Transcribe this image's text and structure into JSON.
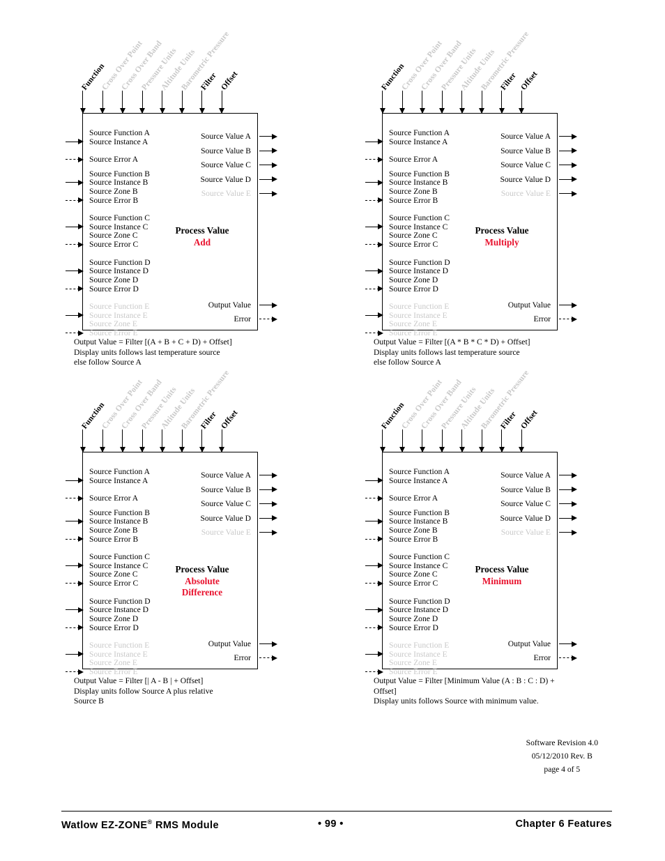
{
  "page": {
    "background": "#ffffff",
    "dim_color": "#c9c9c9",
    "accent_color": "#e8112d"
  },
  "parameters": [
    {
      "label": "Function",
      "dim": false
    },
    {
      "label": "Cross Over Point",
      "dim": true
    },
    {
      "label": "Cross Over Band",
      "dim": true
    },
    {
      "label": "Pressure Units",
      "dim": true
    },
    {
      "label": "Altitude Units",
      "dim": true
    },
    {
      "label": "Barometric Pressure",
      "dim": true
    },
    {
      "label": "Filter",
      "dim": false
    },
    {
      "label": "Offset",
      "dim": false
    }
  ],
  "inputs": [
    {
      "label": "Source Function A",
      "dim": false,
      "arrow": "none"
    },
    {
      "label": "Source Instance A",
      "dim": false,
      "arrow": "solid"
    },
    {
      "label": "Source Error A",
      "dim": false,
      "arrow": "dashed"
    },
    {
      "label": "Source Function B",
      "dim": false,
      "arrow": "none"
    },
    {
      "label": "Source Instance B",
      "dim": false,
      "arrow": "solid"
    },
    {
      "label": "Source Zone B",
      "dim": false,
      "arrow": "none"
    },
    {
      "label": "Source Error B",
      "dim": false,
      "arrow": "dashed"
    },
    {
      "label": "Source Function C",
      "dim": false,
      "arrow": "none"
    },
    {
      "label": "Source Instance C",
      "dim": false,
      "arrow": "solid"
    },
    {
      "label": "Source Zone C",
      "dim": false,
      "arrow": "none"
    },
    {
      "label": "Source Error C",
      "dim": false,
      "arrow": "dashed"
    },
    {
      "label": "Source Function D",
      "dim": false,
      "arrow": "none"
    },
    {
      "label": "Source Instance D",
      "dim": false,
      "arrow": "solid"
    },
    {
      "label": "Source Zone D",
      "dim": false,
      "arrow": "none"
    },
    {
      "label": "Source Error D",
      "dim": false,
      "arrow": "dashed"
    },
    {
      "label": "Source Function E",
      "dim": true,
      "arrow": "none"
    },
    {
      "label": "Source Instance E",
      "dim": true,
      "arrow": "solid"
    },
    {
      "label": "Source Zone E",
      "dim": true,
      "arrow": "none"
    },
    {
      "label": "Source Error E",
      "dim": true,
      "arrow": "dashed"
    }
  ],
  "outputs": [
    {
      "label": "Source Value A",
      "dim": false,
      "arrow": "solid"
    },
    {
      "label": "Source Value B",
      "dim": false,
      "arrow": "solid"
    },
    {
      "label": "Source Value C",
      "dim": false,
      "arrow": "solid"
    },
    {
      "label": "Source Value D",
      "dim": false,
      "arrow": "solid"
    },
    {
      "label": "Source Value E",
      "dim": true,
      "arrow": "solid"
    },
    {
      "label": "Output Value",
      "dim": false,
      "arrow": "solid"
    },
    {
      "label": "Error",
      "dim": false,
      "arrow": "dashed"
    }
  ],
  "diagrams": [
    {
      "title": "Process Value",
      "operation": "Add",
      "operation_lines": [
        "Add"
      ],
      "caption": [
        "Output Value = Filter [(A + B + C + D) + Offset]",
        "Display units follows last temperature source",
        "else follow Source A"
      ]
    },
    {
      "title": "Process Value",
      "operation": "Multiply",
      "operation_lines": [
        "Multiply"
      ],
      "caption": [
        "Output Value = Filter [(A * B * C * D) + Offset]",
        "Display units follows last temperature source",
        "else follow Source A"
      ]
    },
    {
      "title": "Process Value",
      "operation": "Absolute Difference",
      "operation_lines": [
        "Absolute",
        "Difference"
      ],
      "caption": [
        "Output Value = Filter [| A -  B | + Offset]",
        "Display units follow Source A plus relative",
        "Source B"
      ]
    },
    {
      "title": "Process Value",
      "operation": "Minimum",
      "operation_lines": [
        "Minimum"
      ],
      "caption": [
        "Output Value = Filter [Minimum Value (A : B : C : D) +",
        "Offset]",
        "Display units follows Source with minimum value."
      ]
    }
  ],
  "revision": {
    "software": "Software Revision 4.0",
    "date": "05/12/2010 Rev. B",
    "page": "page 4 of 5"
  },
  "footer": {
    "left_pre": "Watlow EZ-ZONE",
    "left_sup": "®",
    "left_post": " RMS Module",
    "center": "•  99  •",
    "right": "Chapter 6 Features"
  }
}
